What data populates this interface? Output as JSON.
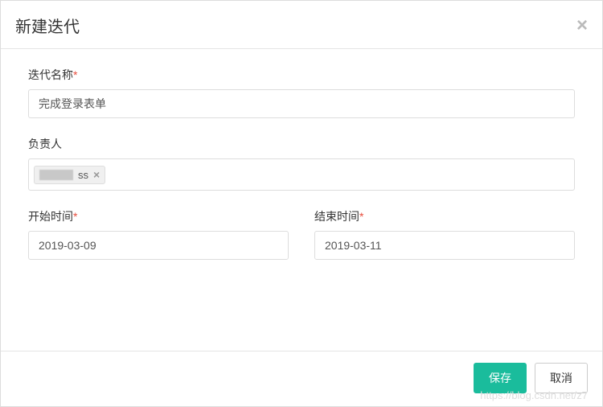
{
  "header": {
    "title": "新建迭代"
  },
  "fields": {
    "iteration_name": {
      "label": "迭代名称",
      "required_mark": "*",
      "value": "完成登录表单"
    },
    "owner": {
      "label": "负责人",
      "tag_suffix": "ss"
    },
    "start_time": {
      "label": "开始时间",
      "required_mark": "*",
      "value": "2019-03-09"
    },
    "end_time": {
      "label": "结束时间",
      "required_mark": "*",
      "value": "2019-03-11"
    }
  },
  "footer": {
    "save_label": "保存",
    "cancel_label": "取消"
  },
  "watermark": "https://blog.csdn.net/z7"
}
